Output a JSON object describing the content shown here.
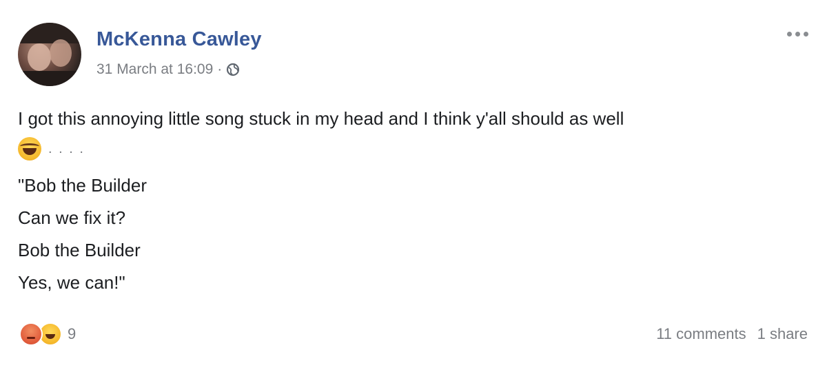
{
  "post": {
    "author": "McKenna Cawley",
    "timestamp": "31 March at 16:09",
    "separator": "·",
    "privacy_icon": "globe-icon",
    "more_icon": "more-options-icon",
    "text_line1": "I got this annoying little song stuck in my head and I think y'all should as well",
    "emoji": "laughing-emoji",
    "trailing_dots": ". . . .",
    "lyrics": [
      "\"Bob the Builder",
      "Can we fix it?",
      "Bob the Builder",
      "Yes, we can!\""
    ]
  },
  "footer": {
    "reaction_icons": [
      "angry-reaction-icon",
      "haha-reaction-icon"
    ],
    "reaction_count": "9",
    "comments": "11 comments",
    "shares": "1 share"
  },
  "colors": {
    "author": "#385898",
    "meta": "#7a7d82",
    "text": "#1c1e21"
  }
}
